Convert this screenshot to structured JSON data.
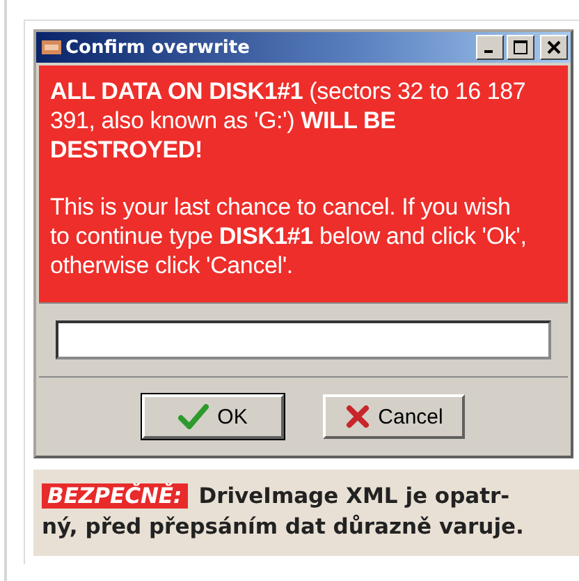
{
  "window": {
    "title": "Confirm overwrite"
  },
  "message": {
    "paragraphs": [
      "**ALL DATA ON DISK1#1** (sectors 32 to 16 187 391, also known as 'G:') **WILL BE DESTROYED!**",
      "This is your last chance to cancel. If you wish to continue type **DISK1#1** below and click 'Ok', otherwise click 'Cancel'."
    ]
  },
  "buttons": [
    {
      "kind": "ok",
      "label": "OK",
      "default": true
    },
    {
      "kind": "cancel",
      "label": "Cancel",
      "default": false
    }
  ],
  "caption": {
    "tag": "BEZPEČNĚ:",
    "text": "DriveImage XML je opatr-\nný, před přepsáním dat důrazně varuje."
  }
}
